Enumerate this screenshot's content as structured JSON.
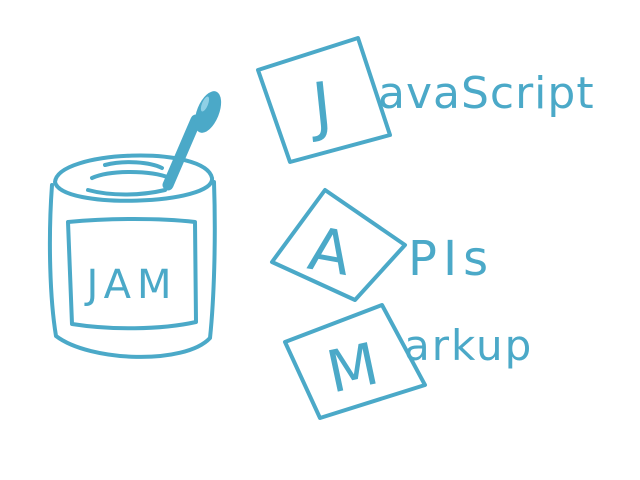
{
  "ink_color": "#4ba9c8",
  "jar": {
    "label": "JAM"
  },
  "rows": [
    {
      "letter": "J",
      "rest": "avaScript"
    },
    {
      "letter": "A",
      "rest": "PIs"
    },
    {
      "letter": "M",
      "rest": "arkup"
    }
  ]
}
